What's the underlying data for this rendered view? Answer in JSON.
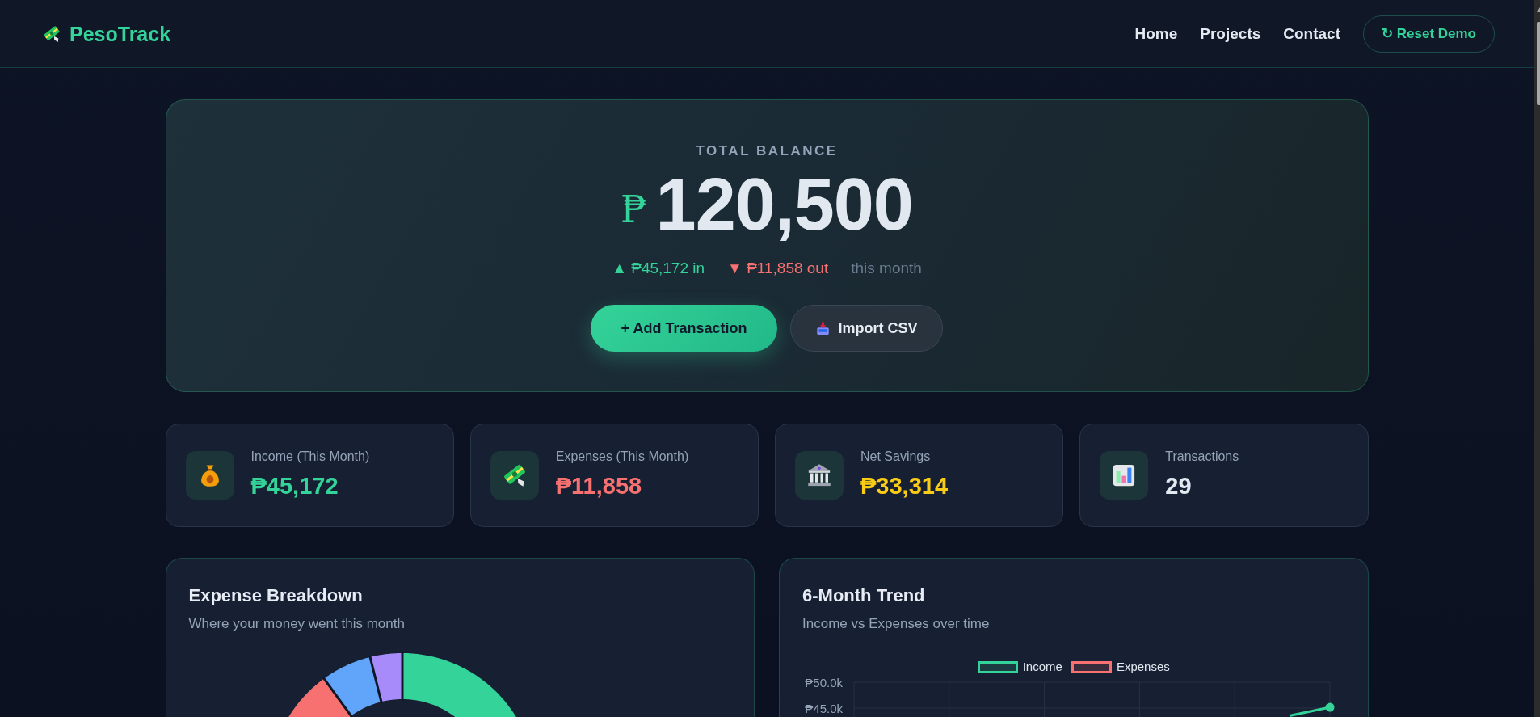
{
  "header": {
    "brand": "PesoTrack",
    "nav": [
      "Home",
      "Projects",
      "Contact"
    ],
    "action": "↻ Reset Demo"
  },
  "balance": {
    "label": "TOTAL BALANCE",
    "currency": "₱",
    "amount": "120,500",
    "flows": [
      {
        "text": "▲ ₱45,172 in",
        "color": "#34d399"
      },
      {
        "text": "▼ ₱11,858 out",
        "color": "#f87171"
      }
    ],
    "period": "this month",
    "buttons": [
      {
        "kind": "primary",
        "label": "+ Add Transaction"
      },
      {
        "kind": "secondary",
        "label": "Import CSV"
      }
    ]
  },
  "stats": [
    {
      "kind": "income",
      "label": "Income (This Month)",
      "value": "₱45,172",
      "color": "#34d399"
    },
    {
      "kind": "expenses",
      "label": "Expenses (This Month)",
      "value": "₱11,858",
      "color": "#f87171"
    },
    {
      "kind": "savings",
      "label": "Net Savings",
      "value": "₱33,314",
      "color": "#facc15"
    },
    {
      "kind": "transactions",
      "label": "Transactions",
      "value": "29",
      "color": "#e2e8f0"
    }
  ],
  "charts": [
    {
      "kind": "donut",
      "title": "Expense Breakdown",
      "subtitle": "Where your money went this month"
    },
    {
      "kind": "trend",
      "title": "6-Month Trend",
      "subtitle": "Income vs Expenses over time",
      "legend": [
        {
          "name": "Income",
          "color": "#34d399"
        },
        {
          "name": "Expenses",
          "color": "#f87171"
        }
      ],
      "y_labels": [
        "₱50.0k",
        "₱45.0k"
      ]
    }
  ]
}
